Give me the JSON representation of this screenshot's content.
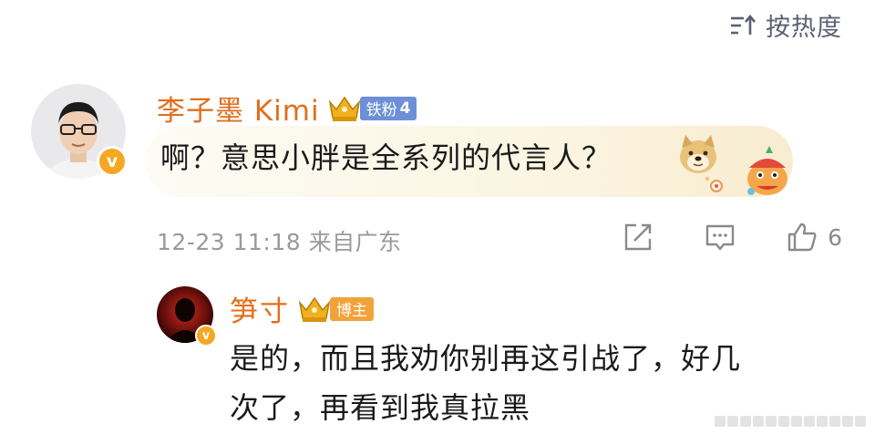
{
  "sort": {
    "label": "按热度",
    "icon": "sort-icon"
  },
  "comment": {
    "username": "李子墨 Kimi",
    "fan_badge": {
      "text": "铁粉",
      "level": "4"
    },
    "verified_icon": "v-badge-icon",
    "text": "啊？意思小胖是全系列的代言人？",
    "emoji": "doge-emoji",
    "meta": "12-23 11:18 来自广东",
    "like_count": "6",
    "actions": [
      "share-icon",
      "reply-icon",
      "like-icon"
    ]
  },
  "reply": {
    "username": "笋寸",
    "badge": "博主",
    "verified_icon": "v-badge-icon",
    "text_line1": "是的，而且我劝你别再这引战了，好几",
    "text_line2": "次了，再看到我真拉黑"
  },
  "colors": {
    "username": "#e26e1c",
    "fan_badge": "#6d8fd6",
    "blogger_badge": "#f2a23a",
    "meta_text": "#9a9a9a",
    "sort_text": "#5b6172",
    "bubble": "#fbf5e2"
  }
}
